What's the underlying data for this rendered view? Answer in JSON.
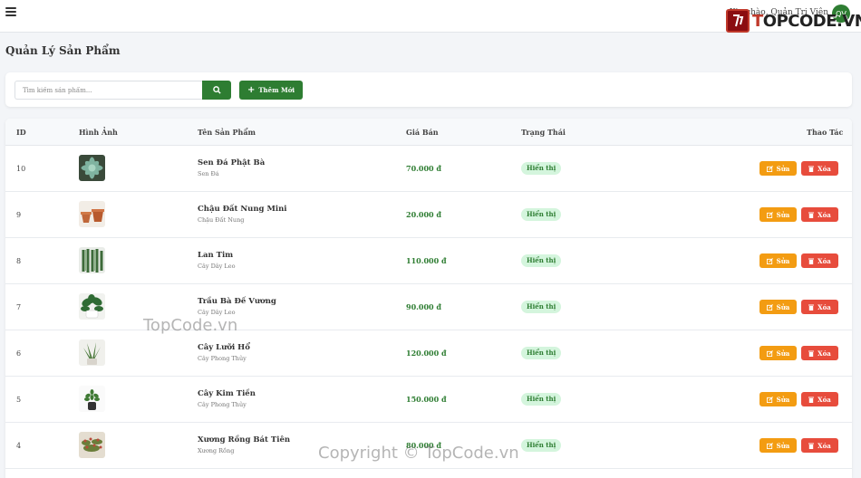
{
  "header": {
    "greeting": "Xin chào, Quản Trị Viên",
    "avatar_initials": "QV",
    "avatar_color": "#2e7d32",
    "logo_text": "TOPCODE.VN",
    "menu_icon": "hamburger-menu-icon"
  },
  "page": {
    "title": "Quản Lý Sản Phẩm"
  },
  "search": {
    "placeholder": "Tìm kiếm sản phẩm...",
    "button_icon": "search-icon",
    "add_label": "Thêm Mới"
  },
  "table": {
    "columns": [
      "ID",
      "Hình Ảnh",
      "Tên Sản Phẩm",
      "Giá Bán",
      "Trạng Thái",
      "Thao Tác"
    ],
    "rows": [
      {
        "id": "10",
        "name": "Sen Đá Phật Bà",
        "category": "Sen Đá",
        "price": "70.000 đ",
        "status": "Hiển thị",
        "image": "succulent"
      },
      {
        "id": "9",
        "name": "Chậu Đất Nung Mini",
        "category": "Chậu Đất Nung",
        "price": "20.000 đ",
        "status": "Hiển thị",
        "image": "clay-pots"
      },
      {
        "id": "8",
        "name": "Lan Tim",
        "category": "Cây Dây Leo",
        "price": "110.000 đ",
        "status": "Hiển thị",
        "image": "purple-hanging-plant"
      },
      {
        "id": "7",
        "name": "Trầu Bà Đế Vương",
        "category": "Cây Dây Leo",
        "price": "90.000 đ",
        "status": "Hiển thị",
        "image": "philodendron"
      },
      {
        "id": "6",
        "name": "Cây Lưỡi Hổ",
        "category": "Cây Phong Thủy",
        "price": "120.000 đ",
        "status": "Hiển thị",
        "image": "snake-plant"
      },
      {
        "id": "5",
        "name": "Cây Kim Tiền",
        "category": "Cây Phong Thủy",
        "price": "150.000 đ",
        "status": "Hiển thị",
        "image": "zz-plant"
      },
      {
        "id": "4",
        "name": "Xương Rồng Bát Tiên",
        "category": "Xương Rồng",
        "price": "80.000 đ",
        "status": "Hiển thị",
        "image": "crown-of-thorns"
      }
    ],
    "edit_label": "Sửa",
    "delete_label": "Xóa",
    "edit_color": "#f39c12",
    "delete_color": "#e74c3c",
    "status_color": "#2e7d32"
  },
  "watermarks": {
    "mid": "TopCode.vn",
    "bottom": "Copyright © TopCode.vn"
  }
}
